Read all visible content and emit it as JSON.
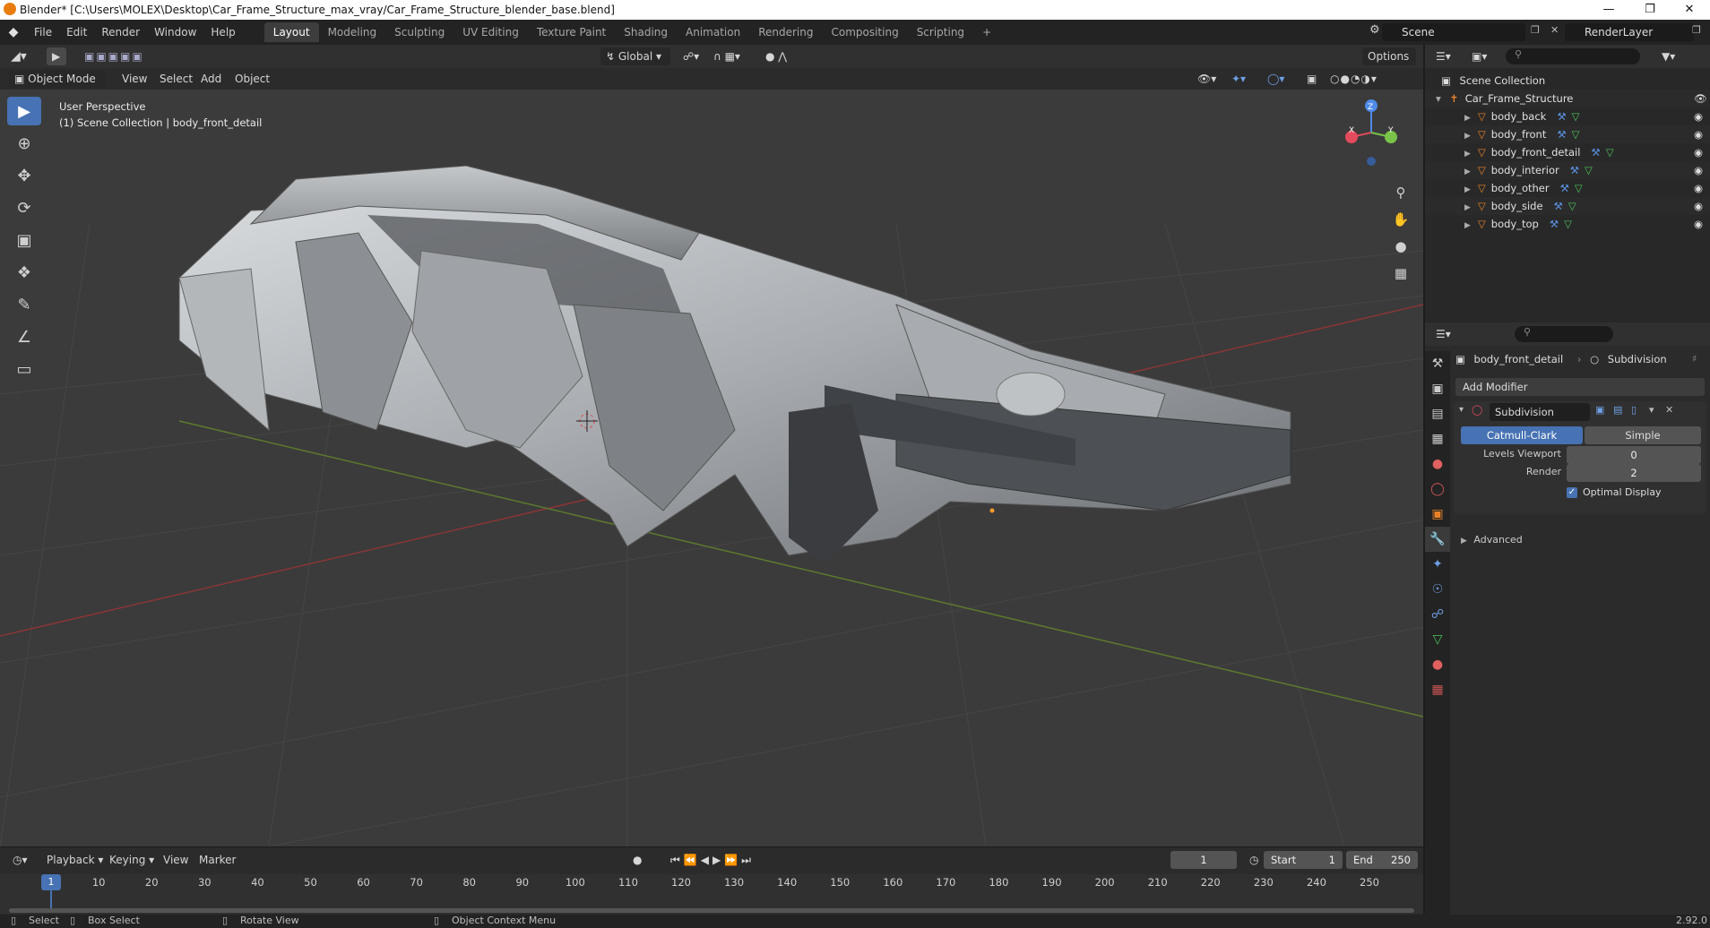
{
  "window": {
    "title": "Blender* [C:\\Users\\MOLEX\\Desktop\\Car_Frame_Structure_max_vray/Car_Frame_Structure_blender_base.blend]",
    "minimize_icon": "minimize-icon",
    "maximize_icon": "restore-icon",
    "close_icon": "close-icon"
  },
  "menu": [
    "File",
    "Edit",
    "Render",
    "Window",
    "Help"
  ],
  "workspaces": [
    "Layout",
    "Modeling",
    "Sculpting",
    "UV Editing",
    "Texture Paint",
    "Shading",
    "Animation",
    "Rendering",
    "Compositing",
    "Scripting",
    "+"
  ],
  "active_workspace": "Layout",
  "scene": {
    "name": "Scene",
    "render_layer": "RenderLayer"
  },
  "viewport_header": {
    "transform_orientation": "Global",
    "options": "Options"
  },
  "viewport_sub": {
    "mode": "Object Mode",
    "menus": [
      "View",
      "Select",
      "Add",
      "Object"
    ]
  },
  "viewport": {
    "overlay_line1": "User Perspective",
    "overlay_line2": "(1) Scene Collection | body_front_detail",
    "gizmo_axes": [
      "X",
      "Y",
      "Z"
    ]
  },
  "tools": [
    "select-box-icon",
    "cursor-icon",
    "move-icon",
    "rotate-icon",
    "scale-icon",
    "transform-icon",
    "annotate-icon",
    "measure-icon",
    "add-cube-icon"
  ],
  "outliner": {
    "root": "Scene Collection",
    "collection": "Car_Frame_Structure",
    "objects": [
      "body_back",
      "body_front",
      "body_front_detail",
      "body_interior",
      "body_other",
      "body_side",
      "body_top"
    ],
    "selected": "body_front_detail"
  },
  "properties": {
    "object": "body_front_detail",
    "modifier_context": "Subdivision",
    "add_modifier": "Add Modifier",
    "modifier_name": "Subdivision",
    "algorithm_options": [
      "Catmull-Clark",
      "Simple"
    ],
    "algorithm_selected": "Catmull-Clark",
    "levels_viewport_label": "Levels Viewport",
    "levels_viewport": "0",
    "render_label": "Render",
    "render": "2",
    "optimal_display_label": "Optimal Display",
    "optimal_display": true,
    "advanced": "Advanced"
  },
  "timeline": {
    "menus": [
      "Playback",
      "Keying",
      "View",
      "Marker"
    ],
    "current_frame": "1",
    "start_label": "Start",
    "start": "1",
    "end_label": "End",
    "end": "250",
    "ticks": [
      "1",
      "10",
      "20",
      "30",
      "40",
      "50",
      "60",
      "70",
      "80",
      "90",
      "100",
      "110",
      "120",
      "130",
      "140",
      "150",
      "160",
      "170",
      "180",
      "190",
      "200",
      "210",
      "220",
      "230",
      "240",
      "250"
    ]
  },
  "statusbar": {
    "items": [
      "Select",
      "Box Select",
      "Rotate View",
      "Object Context Menu"
    ],
    "version": "2.92.0"
  },
  "colors": {
    "accent": "#4772b3",
    "viewport_bg": "#3b3b3b",
    "object_orange": "#e8822a",
    "modifier_blue": "#5a8fdc",
    "mesh_green": "#4cc35a"
  }
}
